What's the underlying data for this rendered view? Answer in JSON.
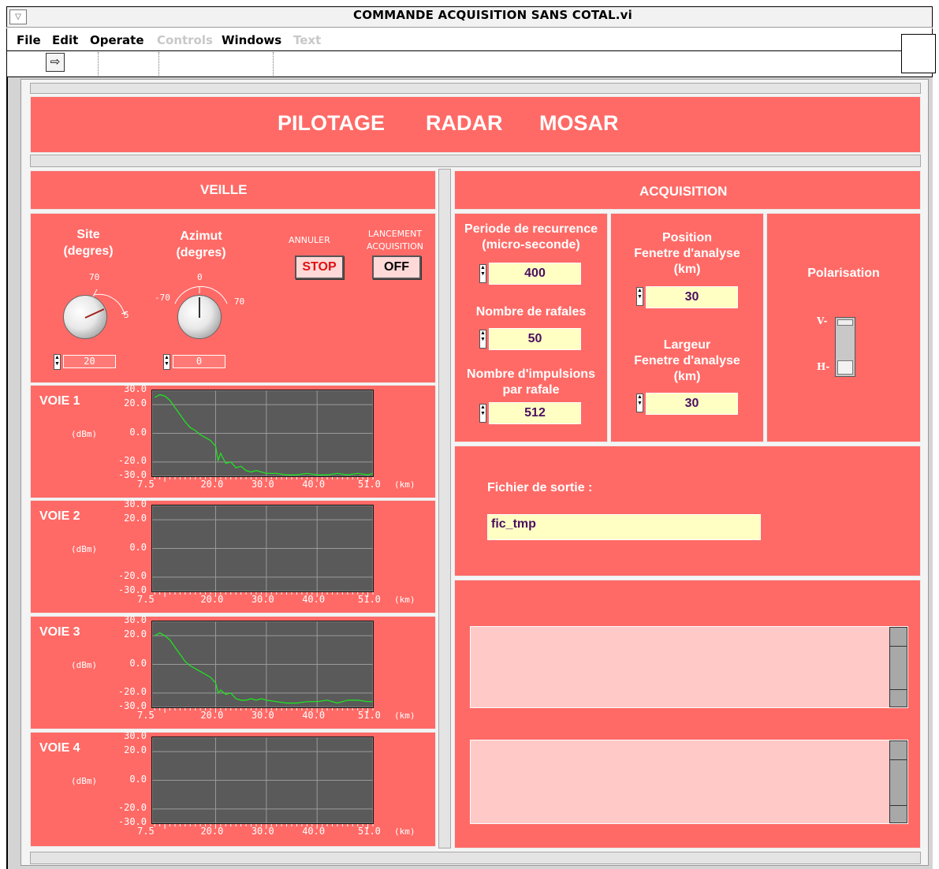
{
  "window": {
    "title": "COMMANDE ACQUISITION SANS COTAL.vi",
    "system_menu_icon": "triangle-down-icon"
  },
  "menu": {
    "file": "File",
    "edit": "Edit",
    "operate": "Operate",
    "controls": "Controls",
    "windows": "Windows",
    "text": "Text"
  },
  "toolbar": {
    "run_icon": "run-arrow-icon"
  },
  "panel": {
    "title": {
      "w1": "PILOTAGE",
      "w2": "RADAR",
      "w3": "MOSAR"
    },
    "veille": {
      "header": "VEILLE",
      "site": {
        "label1": "Site",
        "label2": "(degres)",
        "scale": [
          "70",
          "5"
        ],
        "value": "20"
      },
      "azimut": {
        "label1": "Azimut",
        "label2": "(degres)",
        "scale": [
          "0",
          "-70",
          "70"
        ],
        "value": "0"
      },
      "annuler": {
        "label": "ANNULER",
        "button": "STOP"
      },
      "lancement": {
        "label1": "LANCEMENT",
        "label2": "ACQUISITION",
        "button": "OFF"
      },
      "y_unit": "(dBm)",
      "x_unit": "(km)",
      "y_ticks": [
        "30.0",
        "20.0",
        "0.0",
        "-20.0",
        "-30.0"
      ],
      "x_ticks": [
        "7.5",
        "20.0",
        "30.0",
        "40.0",
        "51.0"
      ]
    },
    "acquisition": {
      "header": "ACQUISITION",
      "periode": {
        "label1": "Periode de recurrence",
        "label2": "(micro-seconde)",
        "value": "400"
      },
      "rafales": {
        "label": "Nombre de rafales",
        "value": "50"
      },
      "impulsions": {
        "label1": "Nombre d'impulsions",
        "label2": "par rafale",
        "value": "512"
      },
      "position": {
        "label1": "Position",
        "label2": "Fenetre d'analyse",
        "label3": "(km)",
        "value": "30"
      },
      "largeur": {
        "label1": "Largeur",
        "label2": "Fenetre d'analyse",
        "label3": "(km)",
        "value": "30"
      },
      "polarisation": {
        "label": "Polarisation",
        "v": "V-",
        "h": "H-",
        "selected": "V"
      },
      "fichier": {
        "label": "Fichier de sortie :",
        "value": "fic_tmp"
      }
    }
  },
  "chart_data": [
    {
      "type": "line",
      "title": "VOIE 1",
      "ylabel": "(dBm)",
      "xlabel": "(km)",
      "xlim": [
        7.5,
        51.0
      ],
      "ylim": [
        -30,
        30
      ],
      "x_ticks": [
        7.5,
        20.0,
        30.0,
        40.0,
        51.0
      ],
      "y_ticks": [
        30.0,
        20.0,
        0.0,
        -20.0,
        -30.0
      ],
      "grid": true,
      "series": [
        {
          "color": "#22e022",
          "x": [
            8.0,
            9.0,
            10.0,
            11.0,
            12.0,
            13.0,
            14.0,
            15.0,
            16.0,
            17.0,
            18.0,
            19.0,
            20.0,
            20.5,
            21.0,
            22.0,
            23.0,
            24.0,
            25.0,
            26.0,
            27.0,
            28.0,
            29.0,
            30.0,
            32.0,
            34.0,
            36.0,
            38.0,
            40.0,
            42.0,
            44.0,
            46.0,
            48.0,
            50.0,
            51.0
          ],
          "y": [
            25,
            27,
            26,
            23,
            18,
            13,
            8,
            4,
            2,
            -1,
            -3,
            -5,
            -9,
            -19,
            -14,
            -21,
            -20,
            -24,
            -23,
            -26,
            -27,
            -26,
            -27,
            -28,
            -28,
            -29,
            -29,
            -28,
            -29,
            -29,
            -28,
            -29,
            -28,
            -29,
            -28
          ]
        }
      ]
    },
    {
      "type": "line",
      "title": "VOIE 2",
      "ylabel": "(dBm)",
      "xlabel": "(km)",
      "xlim": [
        7.5,
        51.0
      ],
      "ylim": [
        -30,
        30
      ],
      "x_ticks": [
        7.5,
        20.0,
        30.0,
        40.0,
        51.0
      ],
      "y_ticks": [
        30.0,
        20.0,
        0.0,
        -20.0,
        -30.0
      ],
      "grid": true,
      "series": []
    },
    {
      "type": "line",
      "title": "VOIE 3",
      "ylabel": "(dBm)",
      "xlabel": "(km)",
      "xlim": [
        7.5,
        51.0
      ],
      "ylim": [
        -30,
        30
      ],
      "x_ticks": [
        7.5,
        20.0,
        30.0,
        40.0,
        51.0
      ],
      "y_ticks": [
        30.0,
        20.0,
        0.0,
        -20.0,
        -30.0
      ],
      "grid": true,
      "series": [
        {
          "color": "#22e022",
          "x": [
            8.0,
            9.0,
            10.0,
            11.0,
            12.0,
            13.0,
            14.0,
            15.0,
            16.0,
            17.0,
            18.0,
            19.0,
            20.0,
            20.5,
            21.0,
            22.0,
            23.0,
            24.0,
            25.0,
            26.0,
            27.0,
            28.0,
            29.0,
            30.0,
            32.0,
            34.0,
            36.0,
            38.0,
            40.0,
            42.0,
            44.0,
            46.0,
            48.0,
            50.0,
            51.0
          ],
          "y": [
            20,
            22,
            20,
            17,
            12,
            7,
            2,
            -1,
            -3,
            -5,
            -7,
            -9,
            -13,
            -20,
            -18,
            -21,
            -20,
            -24,
            -25,
            -25,
            -24,
            -25,
            -24,
            -25,
            -26,
            -27,
            -27,
            -26,
            -26,
            -25,
            -27,
            -25,
            -25,
            -26,
            -26
          ]
        }
      ]
    },
    {
      "type": "line",
      "title": "VOIE 4",
      "ylabel": "(dBm)",
      "xlabel": "(km)",
      "xlim": [
        7.5,
        51.0
      ],
      "ylim": [
        -30,
        30
      ],
      "x_ticks": [
        7.5,
        20.0,
        30.0,
        40.0,
        51.0
      ],
      "y_ticks": [
        30.0,
        20.0,
        0.0,
        -20.0,
        -30.0
      ],
      "grid": true,
      "series": []
    }
  ]
}
